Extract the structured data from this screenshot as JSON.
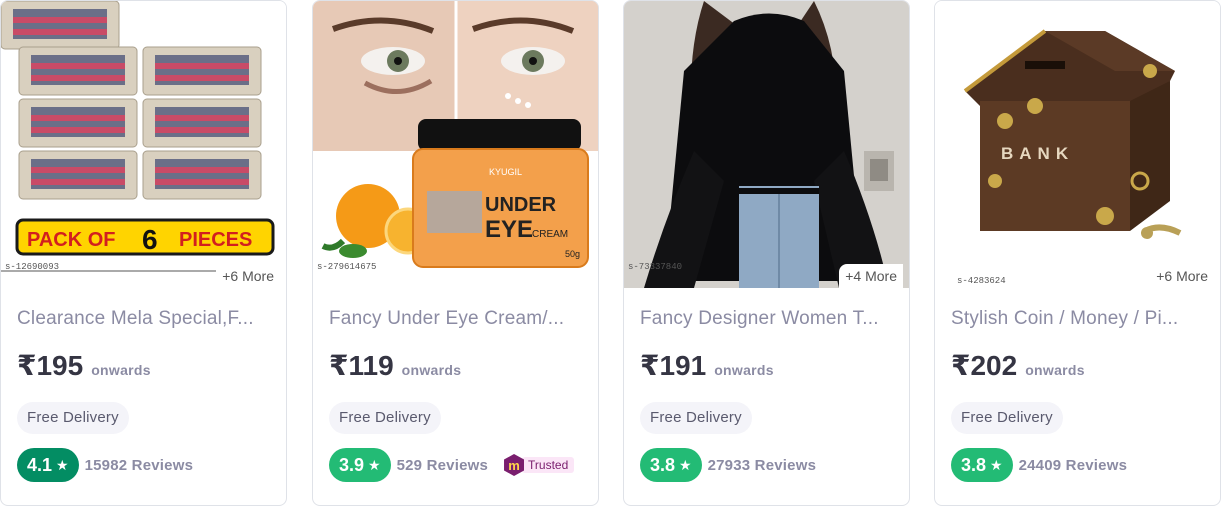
{
  "products": [
    {
      "sku": "s-12690093",
      "more": "+6 More",
      "title": "Clearance Mela Special,F...",
      "price": "₹195",
      "onwards": "onwards",
      "delivery": "Free Delivery",
      "rating": "4.1",
      "rating_color": "#038d63",
      "reviews": "15982 Reviews",
      "image_text": {
        "pack_a": "PACK OF",
        "pack_num": "6",
        "pack_b": "PIECES"
      }
    },
    {
      "sku": "s-279614675",
      "more": "",
      "title": "Fancy Under Eye Cream/...",
      "price": "₹119",
      "onwards": "onwards",
      "delivery": "Free Delivery",
      "rating": "3.9",
      "rating_color": "#23bb75",
      "reviews": "529 Reviews",
      "trusted": "Trusted",
      "image_text": {
        "brand": "KYUGIL",
        "under": "UNDER",
        "eye": "EYE",
        "cream": "CREAM",
        "weight": "50g"
      }
    },
    {
      "sku": "s-73337840",
      "more": "+4 More",
      "title": "Fancy Designer Women T...",
      "price": "₹191",
      "onwards": "onwards",
      "delivery": "Free Delivery",
      "rating": "3.8",
      "rating_color": "#23bb75",
      "reviews": "27933 Reviews"
    },
    {
      "sku": "s-4283624",
      "more": "+6 More",
      "title": "Stylish Coin / Money / Pi...",
      "price": "₹202",
      "onwards": "onwards",
      "delivery": "Free Delivery",
      "rating": "3.8",
      "rating_color": "#23bb75",
      "reviews": "24409 Reviews",
      "image_text": {
        "bank": "BANK"
      }
    }
  ]
}
